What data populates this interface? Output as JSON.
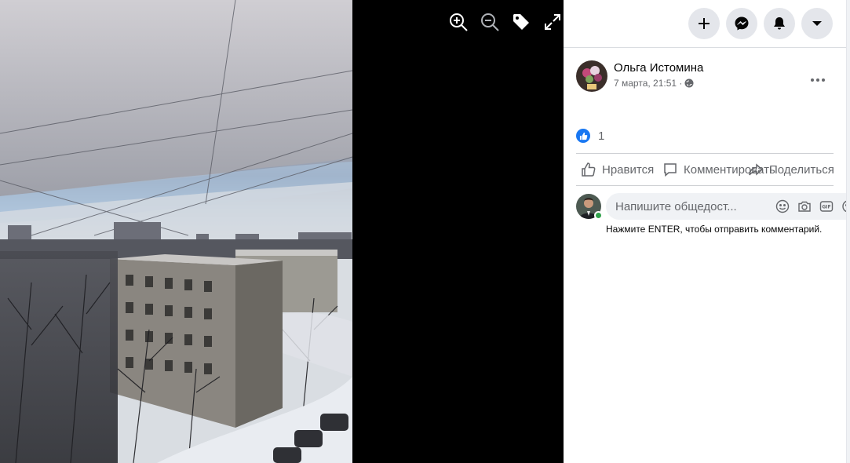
{
  "viewer": {
    "tools": [
      {
        "icon": "zoom-in-icon"
      },
      {
        "icon": "zoom-out-icon"
      },
      {
        "icon": "tag-icon"
      },
      {
        "icon": "fullscreen-icon"
      }
    ]
  },
  "topbar": {
    "buttons": [
      {
        "icon": "plus-icon"
      },
      {
        "icon": "messenger-icon"
      },
      {
        "icon": "bell-icon"
      },
      {
        "icon": "caret-down-icon"
      }
    ]
  },
  "post": {
    "author": "Ольга Истомина",
    "date": "7 марта, 21:51 ·",
    "privacy_icon": "globe-icon",
    "reaction_count": "1"
  },
  "actions": {
    "like": "Нравится",
    "comment": "Комментировать",
    "share": "Поделиться"
  },
  "comment": {
    "placeholder": "Напишите общедост...",
    "hint": "Нажмите ENTER, чтобы отправить комментарий."
  },
  "colors": {
    "brand": "#1877f2",
    "online": "#31a24c",
    "secondary_text": "#65676b"
  }
}
